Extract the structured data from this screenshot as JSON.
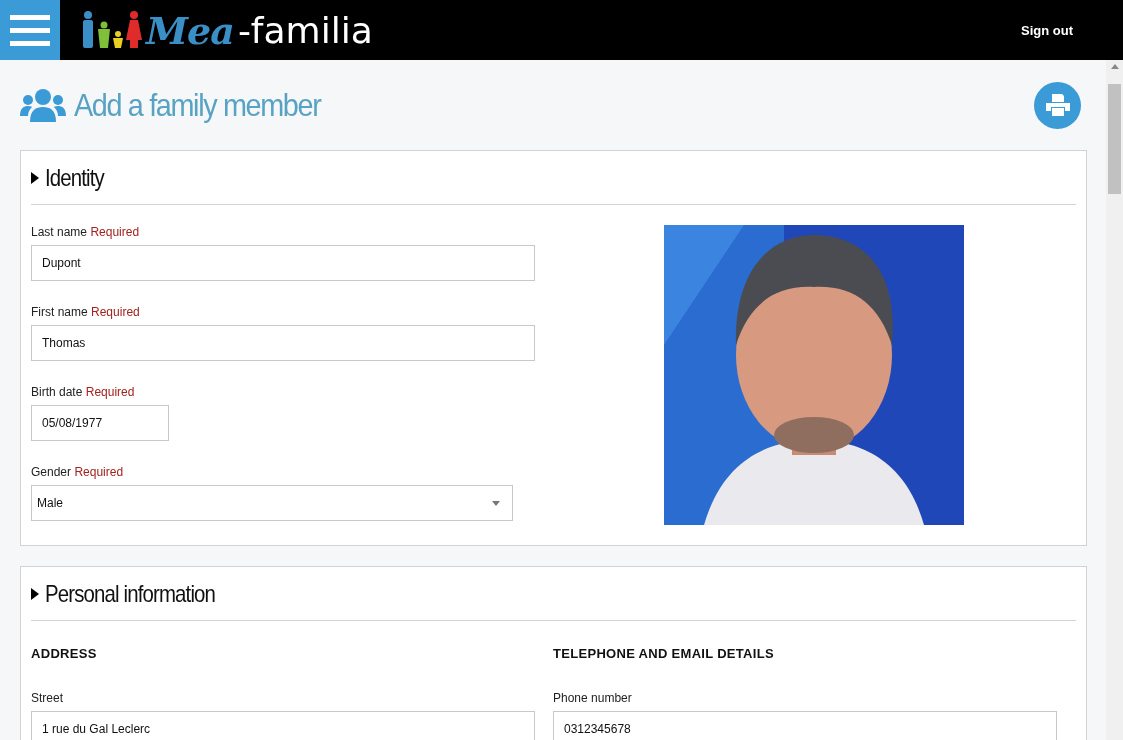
{
  "header": {
    "logo": {
      "mark": "Mea",
      "name": "-familia"
    },
    "sign_out": "Sign out"
  },
  "page": {
    "title": "Add a family member"
  },
  "sections": [
    {
      "title": "Identity",
      "expanded": true,
      "kind": "identity",
      "fields": [
        {
          "kind": "text",
          "label": "Last name",
          "required": "Required",
          "value": "Dupont"
        },
        {
          "kind": "text",
          "label": "First name",
          "required": "Required",
          "value": "Thomas"
        },
        {
          "kind": "date",
          "label": "Birth date",
          "required": "Required",
          "value": "05/08/1977"
        },
        {
          "kind": "select",
          "label": "Gender",
          "required": "Required",
          "value": "Male"
        }
      ]
    },
    {
      "title": "Personal information",
      "expanded": true,
      "kind": "columns",
      "columns": [
        {
          "heading": "ADDRESS",
          "fields": [
            {
              "kind": "text",
              "label": "Street",
              "value": "1 rue du Gal Leclerc"
            }
          ]
        },
        {
          "heading": "TELEPHONE AND EMAIL DETAILS",
          "fields": [
            {
              "kind": "text",
              "label": "Phone number",
              "value": "0312345678"
            }
          ]
        }
      ]
    }
  ]
}
